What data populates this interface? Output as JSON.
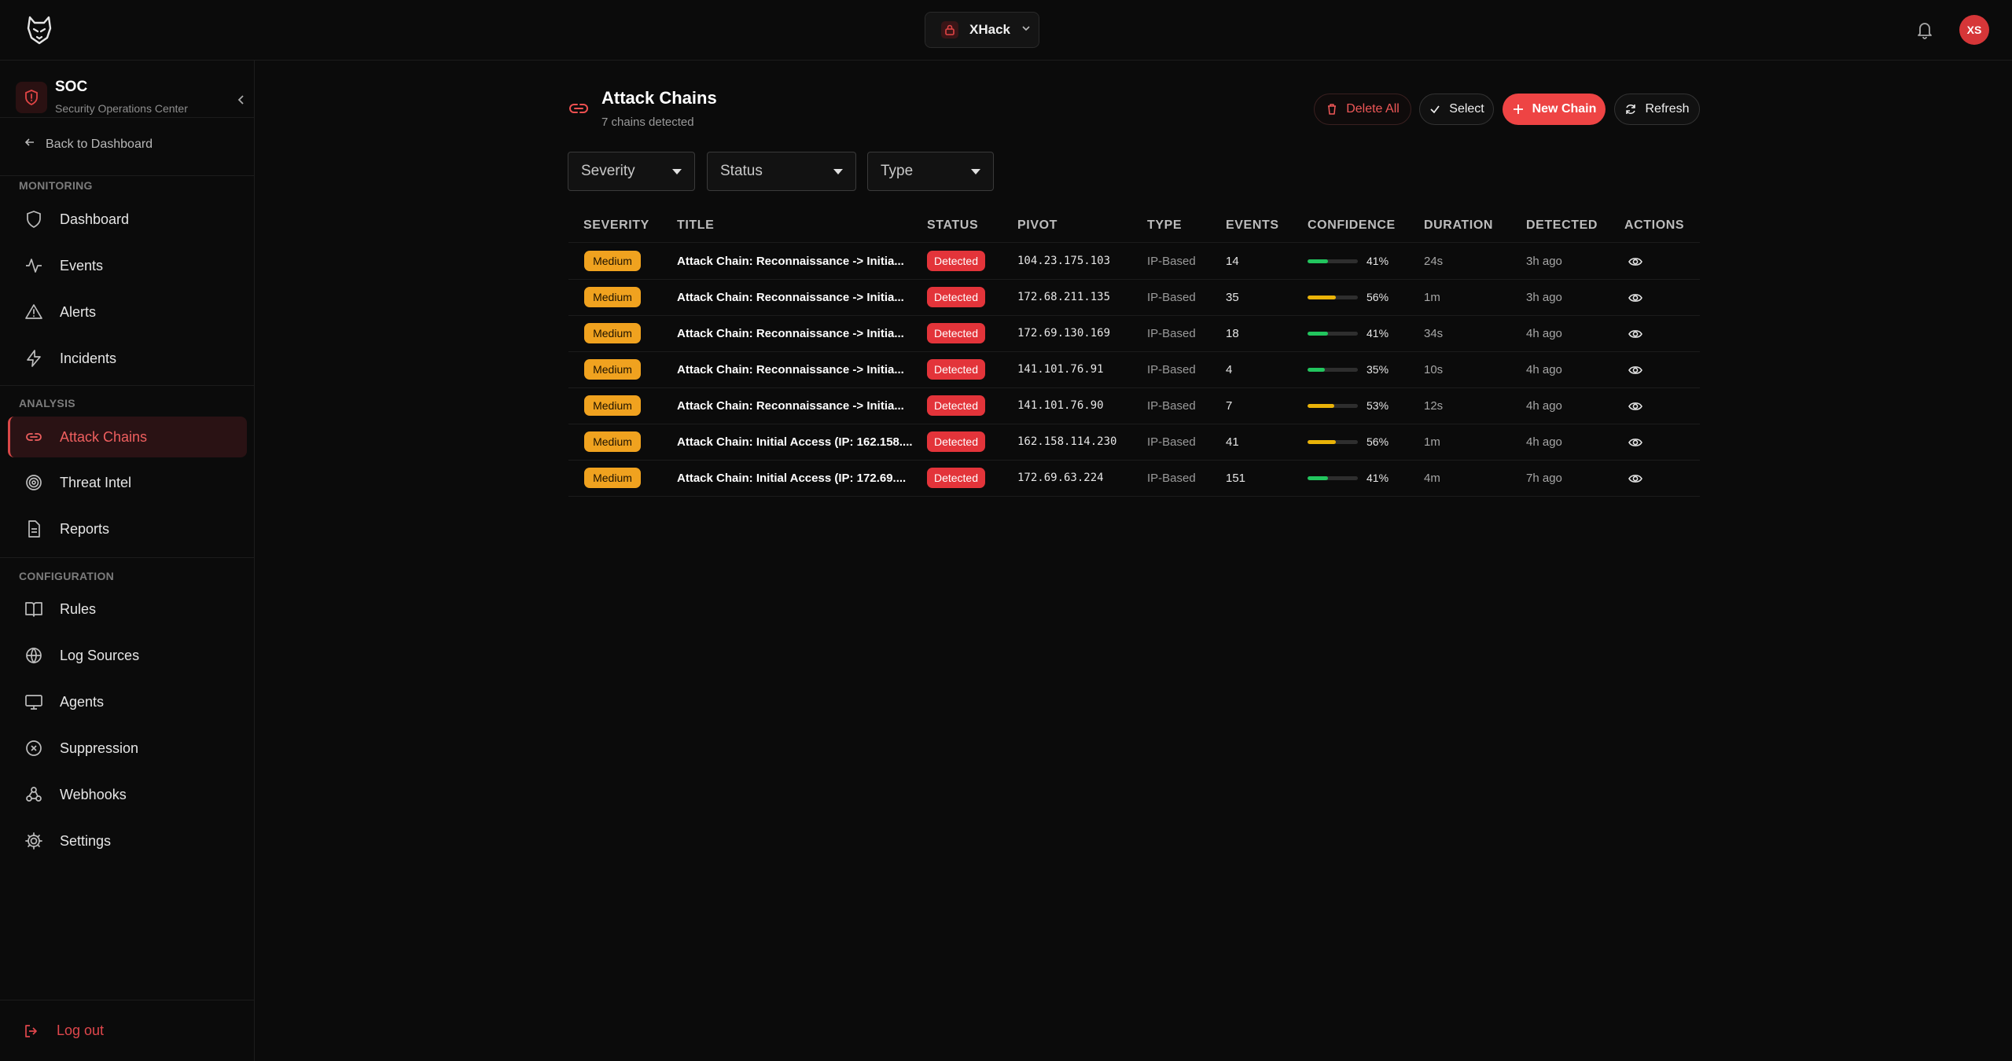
{
  "header": {
    "workspace_name": "XHack",
    "avatar_initials": "XS"
  },
  "sidebar": {
    "app_title": "SOC",
    "app_subtitle": "Security Operations Center",
    "back_label": "Back to Dashboard",
    "sections": [
      {
        "label": "MONITORING",
        "items": [
          {
            "label": "Dashboard",
            "icon": "shield-icon"
          },
          {
            "label": "Events",
            "icon": "activity-icon"
          },
          {
            "label": "Alerts",
            "icon": "alert-triangle-icon"
          },
          {
            "label": "Incidents",
            "icon": "zap-icon"
          }
        ]
      },
      {
        "label": "ANALYSIS",
        "items": [
          {
            "label": "Attack Chains",
            "icon": "link-icon",
            "active": true
          },
          {
            "label": "Threat Intel",
            "icon": "target-icon"
          },
          {
            "label": "Reports",
            "icon": "file-text-icon"
          }
        ]
      },
      {
        "label": "CONFIGURATION",
        "items": [
          {
            "label": "Rules",
            "icon": "book-icon"
          },
          {
            "label": "Log Sources",
            "icon": "globe-icon"
          },
          {
            "label": "Agents",
            "icon": "monitor-icon"
          },
          {
            "label": "Suppression",
            "icon": "x-circle-icon"
          },
          {
            "label": "Webhooks",
            "icon": "webhook-icon"
          },
          {
            "label": "Settings",
            "icon": "gear-icon"
          }
        ]
      }
    ],
    "logout_label": "Log out"
  },
  "main": {
    "title": "Attack Chains",
    "subtitle": "7 chains detected",
    "buttons": {
      "delete_all": "Delete All",
      "select": "Select",
      "new_chain": "New Chain",
      "refresh": "Refresh"
    },
    "filters": {
      "severity": "Severity",
      "status": "Status",
      "type": "Type"
    },
    "columns": [
      "SEVERITY",
      "TITLE",
      "STATUS",
      "PIVOT",
      "TYPE",
      "EVENTS",
      "CONFIDENCE",
      "DURATION",
      "DETECTED",
      "ACTIONS"
    ],
    "rows": [
      {
        "severity": "Medium",
        "title": "Attack Chain: Reconnaissance -> Initia...",
        "status": "Detected",
        "pivot": "104.23.175.103",
        "type": "IP-Based",
        "events": "14",
        "confidence": 41,
        "confidence_label": "41%",
        "duration": "24s",
        "detected": "3h ago"
      },
      {
        "severity": "Medium",
        "title": "Attack Chain: Reconnaissance -> Initia...",
        "status": "Detected",
        "pivot": "172.68.211.135",
        "type": "IP-Based",
        "events": "35",
        "confidence": 56,
        "confidence_label": "56%",
        "duration": "1m",
        "detected": "3h ago"
      },
      {
        "severity": "Medium",
        "title": "Attack Chain: Reconnaissance -> Initia...",
        "status": "Detected",
        "pivot": "172.69.130.169",
        "type": "IP-Based",
        "events": "18",
        "confidence": 41,
        "confidence_label": "41%",
        "duration": "34s",
        "detected": "4h ago"
      },
      {
        "severity": "Medium",
        "title": "Attack Chain: Reconnaissance -> Initia...",
        "status": "Detected",
        "pivot": "141.101.76.91",
        "type": "IP-Based",
        "events": "4",
        "confidence": 35,
        "confidence_label": "35%",
        "duration": "10s",
        "detected": "4h ago"
      },
      {
        "severity": "Medium",
        "title": "Attack Chain: Reconnaissance -> Initia...",
        "status": "Detected",
        "pivot": "141.101.76.90",
        "type": "IP-Based",
        "events": "7",
        "confidence": 53,
        "confidence_label": "53%",
        "duration": "12s",
        "detected": "4h ago"
      },
      {
        "severity": "Medium",
        "title": "Attack Chain: Initial Access (IP: 162.158....",
        "status": "Detected",
        "pivot": "162.158.114.230",
        "type": "IP-Based",
        "events": "41",
        "confidence": 56,
        "confidence_label": "56%",
        "duration": "1m",
        "detected": "4h ago"
      },
      {
        "severity": "Medium",
        "title": "Attack Chain: Initial Access (IP: 172.69....",
        "status": "Detected",
        "pivot": "172.69.63.224",
        "type": "IP-Based",
        "events": "151",
        "confidence": 41,
        "confidence_label": "41%",
        "duration": "4m",
        "detected": "7h ago"
      }
    ]
  },
  "colors": {
    "accent": "#ee4444",
    "severity_medium": "#f0a21f",
    "status_detected": "#e3343a",
    "confidence_low": "#22c55e",
    "confidence_mid": "#eab308"
  }
}
